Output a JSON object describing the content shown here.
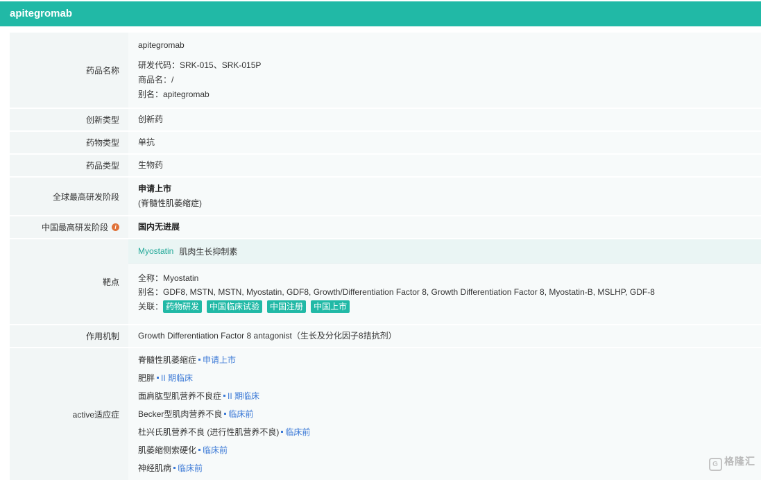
{
  "header": {
    "title": "apitegromab"
  },
  "rows": {
    "drug_name": {
      "label": "药品名称",
      "name": "apitegromab",
      "code": "研发代码：SRK-015、SRK-015P",
      "trade": "商品名：/",
      "alias": "别名：apitegromab"
    },
    "innovation": {
      "label": "创新类型",
      "value": "创新药"
    },
    "drug_type": {
      "label": "药物类型",
      "value": "单抗"
    },
    "product_type": {
      "label": "药品类型",
      "value": "生物药"
    },
    "global_stage": {
      "label": "全球最高研发阶段",
      "value": "申请上市",
      "note": "(脊髓性肌萎缩症)"
    },
    "china_stage": {
      "label": "中国最高研发阶段",
      "value": "国内无进展",
      "info_icon": "i"
    },
    "target": {
      "label": "靶点",
      "name": "Myostatin",
      "cn_name": "肌肉生长抑制素",
      "full_name": "全称：Myostatin",
      "alias": "别名：GDF8, MSTN, MSTN, Myostatin, GDF8, Growth/Differentiation Factor 8, Growth Differentiation Factor 8, Myostatin-B, MSLHP, GDF-8",
      "related_label": "关联：",
      "tags": [
        "药物研发",
        "中国临床试验",
        "中国注册",
        "中国上市"
      ]
    },
    "mechanism": {
      "label": "作用机制",
      "value": "Growth Differentiation Factor 8 antagonist（生长及分化因子8拮抗剂）"
    },
    "indications": {
      "label": "active适应症",
      "items": [
        {
          "name": "脊髓性肌萎缩症",
          "stage": "申请上市"
        },
        {
          "name": "肥胖",
          "stage": "II 期临床"
        },
        {
          "name": "面肩肱型肌营养不良症",
          "stage": "II 期临床"
        },
        {
          "name": "Becker型肌肉营养不良",
          "stage": "临床前"
        },
        {
          "name": "杜兴氏肌营养不良 (进行性肌营养不良)",
          "stage": "临床前"
        },
        {
          "name": "肌萎缩侧索硬化",
          "stage": "临床前"
        },
        {
          "name": "神经肌病",
          "stage": "临床前"
        }
      ]
    }
  },
  "watermark": {
    "text": "格隆汇",
    "icon": "G"
  }
}
